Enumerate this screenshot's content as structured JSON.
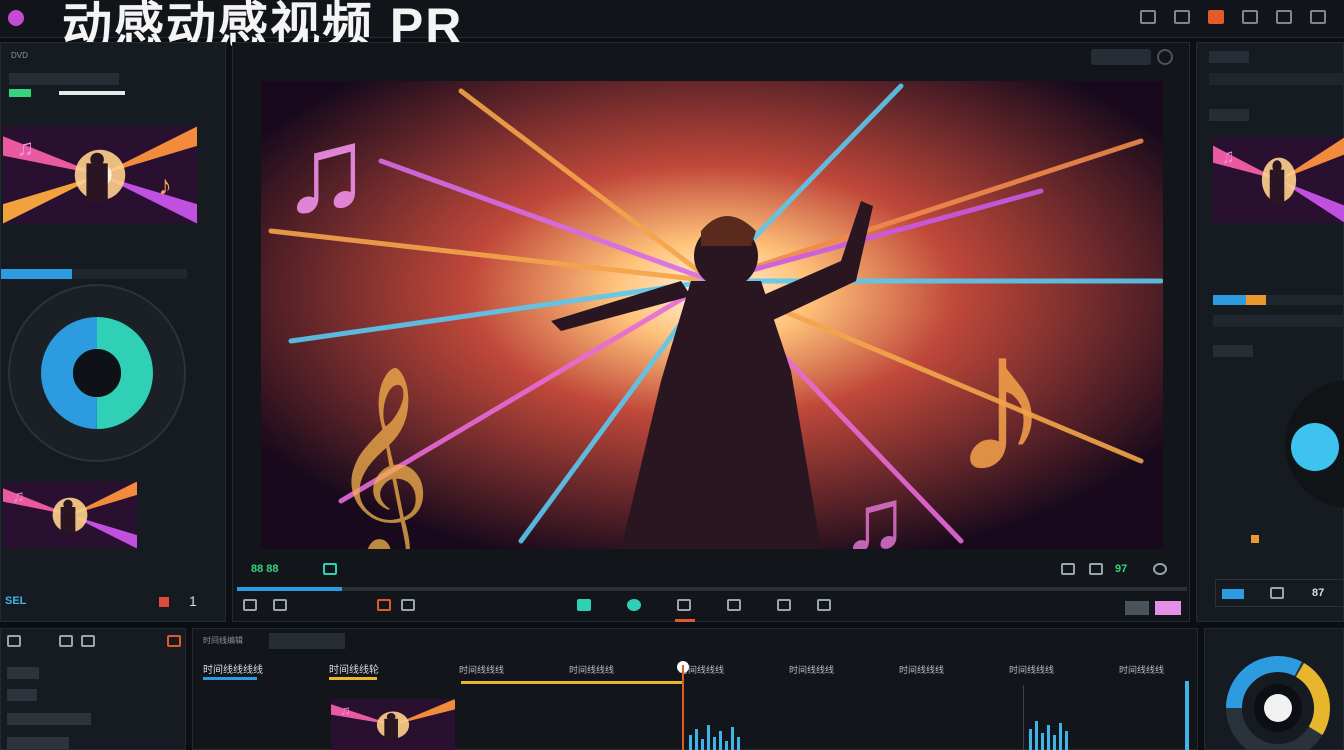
{
  "app": {
    "title": "动感动感视频 PR",
    "accent": "#2d9be0",
    "teal": "#2fd0b5",
    "orange": "#e05a2a",
    "pink": "#e58fe6"
  },
  "left_panel": {
    "tab_label": "DVD",
    "foot_label": "SEL",
    "foot_number": "1",
    "progress_fraction": 0.38,
    "donut": {
      "segments": [
        {
          "color": "#2fd0b5",
          "fraction": 0.5
        },
        {
          "color": "#2d9be0",
          "fraction": 0.5
        }
      ]
    }
  },
  "viewer": {
    "transport_left": "88 88",
    "transport_right": "97"
  },
  "timeline": {
    "title": "时间线编辑",
    "track_a": "时间线线线线",
    "track_b": "时间线线轮",
    "ruler": [
      "时间线线线",
      "时间线线线",
      "时间线线线",
      "时间线线线",
      "时间线线线",
      "时间线线线",
      "时间线线线"
    ],
    "playhead_fraction": 0.3
  },
  "right_panel": {
    "bar_segments": [
      {
        "color": "#2d9be0",
        "fraction": 0.25
      },
      {
        "color": "#e89a2c",
        "fraction": 0.15
      }
    ],
    "donut_color": "#3ec2f0",
    "btn_label": "87"
  }
}
